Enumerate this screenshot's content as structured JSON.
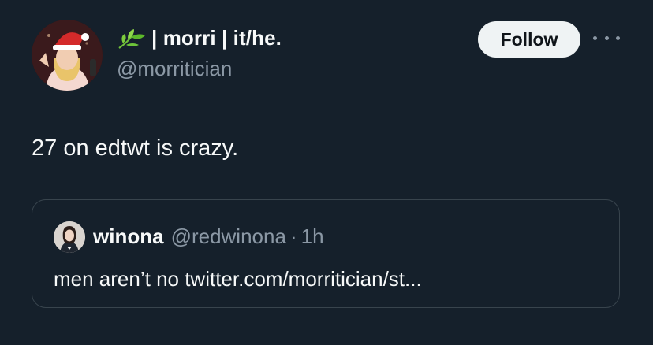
{
  "author": {
    "display_name": "| morri | it/he.",
    "handle": "@morritician",
    "emoji_icon": "leafy-green-emoji",
    "avatar_icon": "santa-hat-avatar"
  },
  "actions": {
    "follow_label": "Follow",
    "more_icon": "more-dots-icon"
  },
  "tweet": {
    "text": "27 on edtwt is crazy."
  },
  "quoted_tweet": {
    "name": "winona",
    "handle": "@redwinona",
    "separator": "·",
    "time": "1h",
    "text": "men aren’t no twitter.com/morritician/st..."
  },
  "colors": {
    "background": "#15202b",
    "primary_text": "#f7f9f9",
    "secondary_text": "#8b98a5",
    "border": "#38444d",
    "follow_bg": "#eff3f4"
  }
}
